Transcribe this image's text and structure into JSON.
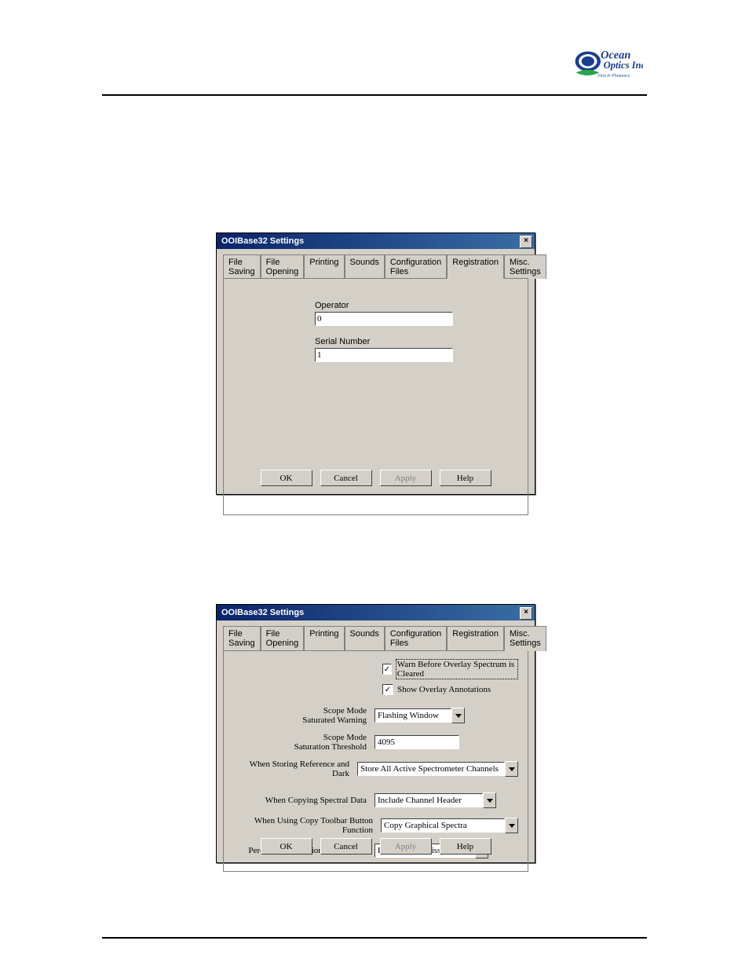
{
  "logo": {
    "primary": "Ocean",
    "secondary": "Optics Inc.",
    "tagline": "First in Photonics"
  },
  "tabs": {
    "file_saving": "File Saving",
    "file_opening": "File Opening",
    "printing": "Printing",
    "sounds": "Sounds",
    "config_files": "Configuration Files",
    "registration": "Registration",
    "misc": "Misc. Settings"
  },
  "dialog1": {
    "title": "OOIBase32 Settings",
    "active_tab": "Registration",
    "operator_label": "Operator",
    "operator_value": "0",
    "serial_label": "Serial Number",
    "serial_value": "1"
  },
  "dialog2": {
    "title": "OOIBase32 Settings",
    "active_tab": "Misc. Settings",
    "chk_warn_label": "Warn Before Overlay Spectrum is Cleared",
    "chk_warn_checked": true,
    "chk_show_label": "Show Overlay Annotations",
    "chk_show_checked": true,
    "row_scope_warn_label": "Scope Mode\nSaturated Warning",
    "row_scope_warn_value": "Flashing Window",
    "row_scope_thresh_label": "Scope Mode\nSaturation Threshold",
    "row_scope_thresh_value": "4095",
    "row_store_label": "When Storing Reference and Dark",
    "row_store_value": "Store All Active Spectrometer Channels",
    "row_copy_label": "When Copying Spectral Data",
    "row_copy_value": "Include Channel Header",
    "row_toolbar_label": "When Using Copy Toolbar Button Function",
    "row_toolbar_value": "Copy Graphical Spectra",
    "row_percent_label": "Percent Transmission Mode Label",
    "row_percent_value": "Percent Transmission"
  },
  "buttons": {
    "ok": "OK",
    "cancel": "Cancel",
    "apply": "Apply",
    "help": "Help"
  },
  "checkmark": "✓"
}
